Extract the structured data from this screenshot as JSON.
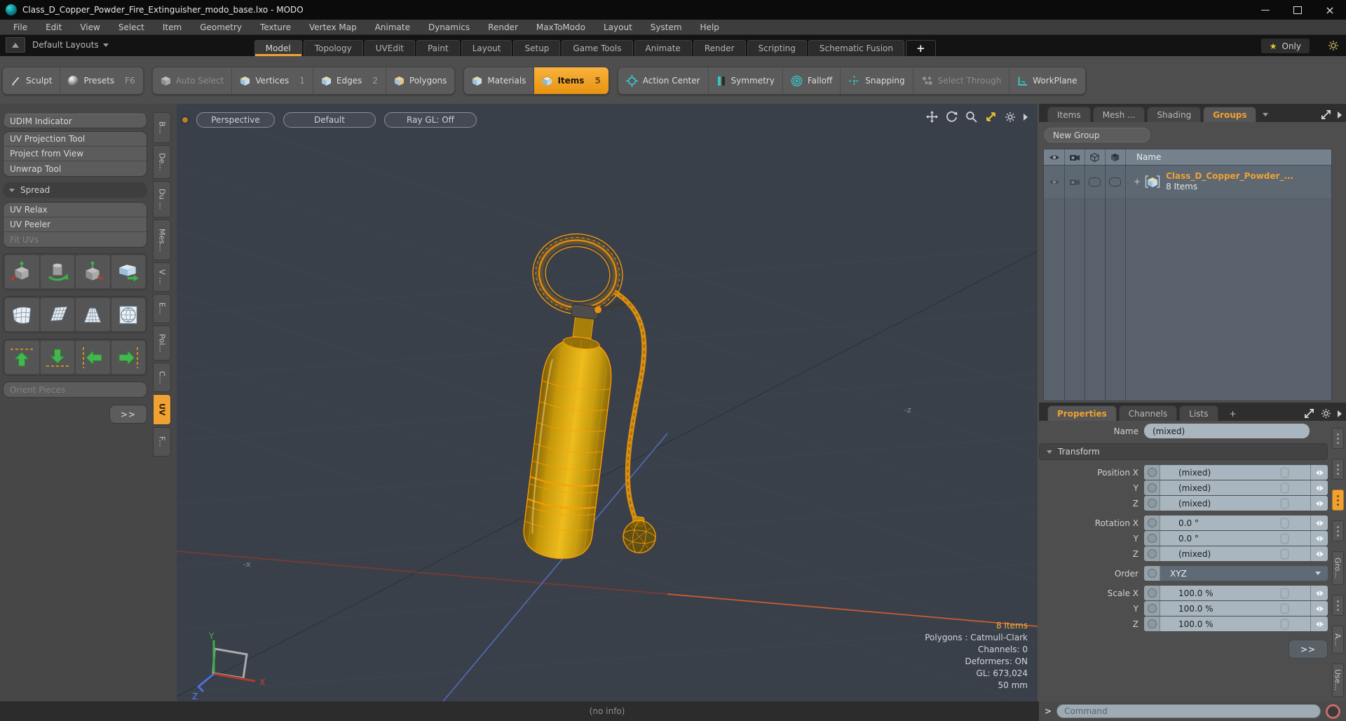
{
  "window": {
    "title": "Class_D_Copper_Powder_Fire_Extinguisher_modo_base.lxo - MODO"
  },
  "icons": {
    "star": "★",
    "close": "×",
    "minimize": "—"
  },
  "menu": {
    "items": [
      "File",
      "Edit",
      "View",
      "Select",
      "Item",
      "Geometry",
      "Texture",
      "Vertex Map",
      "Animate",
      "Dynamics",
      "Render",
      "MaxToModo",
      "Layout",
      "System",
      "Help"
    ]
  },
  "layout_bar": {
    "layout_switcher": "Default Layouts",
    "tabs": [
      "Model",
      "Topology",
      "UVEdit",
      "Paint",
      "Layout",
      "Setup",
      "Game Tools",
      "Animate",
      "Render",
      "Scripting",
      "Schematic Fusion"
    ],
    "active_tab": "Model",
    "add_tab": "+",
    "only_button": "Only"
  },
  "toolbar": {
    "sculpt": "Sculpt",
    "presets": "Presets",
    "presets_shortcut": "F6",
    "auto_select": "Auto Select",
    "vertices": "Vertices",
    "vertices_count": "1",
    "edges": "Edges",
    "edges_count": "2",
    "polygons": "Polygons",
    "materials": "Materials",
    "items": "Items",
    "items_count": "5",
    "action_center": "Action Center",
    "symmetry": "Symmetry",
    "falloff": "Falloff",
    "snapping": "Snapping",
    "select_through": "Select Through",
    "workplane": "WorkPlane"
  },
  "sidebar": {
    "udim_indicator": "UDIM Indicator",
    "uv_projection_tool": "UV Projection Tool",
    "project_from_view": "Project from View",
    "unwrap_tool": "Unwrap Tool",
    "spread_header": "Spread",
    "uv_relax": "UV Relax",
    "uv_peeler": "UV Peeler",
    "fit_uvs": "Fit UVs",
    "orient_pieces": "Orient Pieces",
    "more_button": ">>",
    "vertical_tabs": [
      "B...",
      "De...",
      "Du ...",
      "Mes...",
      "V ...",
      "E...",
      "Pol...",
      "C...",
      "UV",
      "F..."
    ],
    "active_vertical_tab": "UV"
  },
  "viewport": {
    "view_mode": "Perspective",
    "shading_mode": "Default",
    "ray_gl": "Ray GL: Off",
    "axis_label_neg_x": "-x",
    "axis_label_neg_z": "-z",
    "gizmo": {
      "x": "X",
      "y": "Y",
      "z": "Z"
    },
    "stats": {
      "items": "8 Items",
      "polygons": "Polygons : Catmull-Clark",
      "channels": "Channels: 0",
      "deformers": "Deformers: ON",
      "gl": "GL: 673,024",
      "grid_size": "50 mm"
    }
  },
  "right_panel": {
    "tabs": [
      "Items",
      "Mesh ...",
      "Shading",
      "Groups"
    ],
    "active_tab": "Groups",
    "new_group_button": "New Group",
    "tree": {
      "name_header": "Name",
      "expand_plus": "+",
      "group_name": "Class_D_Copper_Powder_...",
      "group_items": "8 Items"
    },
    "properties": {
      "tabs": [
        "Properties",
        "Channels",
        "Lists",
        "+"
      ],
      "active_tab": "Properties",
      "name_label": "Name",
      "name_value": "(mixed)",
      "transform_header": "Transform",
      "rows": [
        {
          "label": "Position X",
          "value": "(mixed)"
        },
        {
          "label": "Y",
          "value": "(mixed)"
        },
        {
          "label": "Z",
          "value": "(mixed)"
        },
        {
          "label": "Rotation X",
          "value": "0.0 °"
        },
        {
          "label": "Y",
          "value": "0.0 °"
        },
        {
          "label": "Z",
          "value": "(mixed)"
        },
        {
          "label": "Order",
          "value": "XYZ"
        },
        {
          "label": "Scale X",
          "value": "100.0 %"
        },
        {
          "label": "Y",
          "value": "100.0 %"
        },
        {
          "label": "Z",
          "value": "100.0 %"
        }
      ],
      "more_button": ">>"
    },
    "side_tabs": [
      "Gro...",
      "A...",
      "Use..."
    ]
  },
  "bottom": {
    "no_info": "(no info)",
    "command_prompt": ">",
    "command_placeholder": "Command"
  },
  "colors": {
    "accent_orange": "#f0a132",
    "teal": "#3ac3c9",
    "viewport_bg": "#3a404a",
    "field_bg": "#a9b6bf",
    "axis_red": "#b8452e",
    "axis_blue": "#5570c8",
    "wire_orange": "#ff9d00",
    "tank_gold": "#d7a90f"
  }
}
